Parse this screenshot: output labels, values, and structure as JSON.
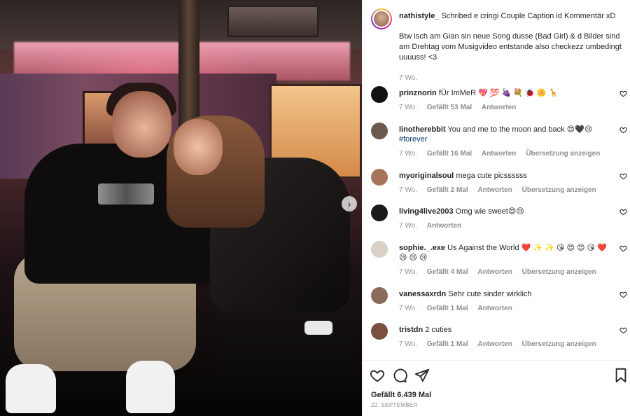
{
  "post": {
    "carousel_next_icon": "chevron-right-icon",
    "author": "nathistyle_",
    "caption_line1": "Schribed e cringi Couple Caption id Kommentär xD",
    "caption_line2": "Btw isch am Gian sin neue Song dusse (Bad Girl) & d Bilder sind am Drehtag vom Musigvideo entstande also checkezz umbedingt uuuuss! <3",
    "caption_time": "7 Wo.",
    "likes": "Gefällt 6.439 Mal",
    "date": "22. SEPTEMBER"
  },
  "comments": [
    {
      "user": "prinznorin",
      "text": "fÜr ImMeR 💖 💯 🍇 💐 🐞 🌼 🦒",
      "time": "7 Wo.",
      "likes": "Gefällt 53 Mal",
      "reply": "Antworten",
      "translate": "",
      "avatar_color": "#111"
    },
    {
      "user": "linotherebbit",
      "text": "You and me to the moon and back 😍🖤😢",
      "tag": "#forever",
      "time": "7 Wo.",
      "likes": "Gefällt 16 Mal",
      "reply": "Antworten",
      "translate": "Übersetzung anzeigen",
      "avatar_color": "#6b5a4e"
    },
    {
      "user": "myoriginalsoul",
      "text": "mega cute picssssss",
      "time": "7 Wo.",
      "likes": "Gefällt 2 Mal",
      "reply": "Antworten",
      "translate": "Übersetzung anzeigen",
      "avatar_color": "#a8745a"
    },
    {
      "user": "living4live2003",
      "text": "Omg wie sweet😍😢",
      "time": "7 Wo.",
      "likes": "",
      "reply": "Antworten",
      "translate": "",
      "avatar_color": "#1a1a1a"
    },
    {
      "user": "sophie._.exe",
      "text": "Us Against the World ❤️ ✨ ✨ 😘 😍 😍 😘 ❤️ 😢 😢 😢",
      "time": "7 Wo.",
      "likes": "Gefällt 4 Mal",
      "reply": "Antworten",
      "translate": "Übersetzung anzeigen",
      "avatar_color": "#d9d0c8"
    },
    {
      "user": "vanessaxrdn",
      "text": "Sehr cute sinder wirklich",
      "time": "7 Wo.",
      "likes": "Gefällt 1 Mal",
      "reply": "Antworten",
      "translate": "",
      "avatar_color": "#8a6a5a"
    },
    {
      "user": "tristdn",
      "text": "2 cuties",
      "time": "7 Wo.",
      "likes": "Gefällt 1 Mal",
      "reply": "Antworten",
      "translate": "Übersetzung anzeigen",
      "avatar_color": "#7a5040"
    }
  ],
  "actions": {
    "like_icon": "heart-icon",
    "comment_icon": "comment-icon",
    "share_icon": "paper-plane-icon",
    "save_icon": "bookmark-icon"
  }
}
